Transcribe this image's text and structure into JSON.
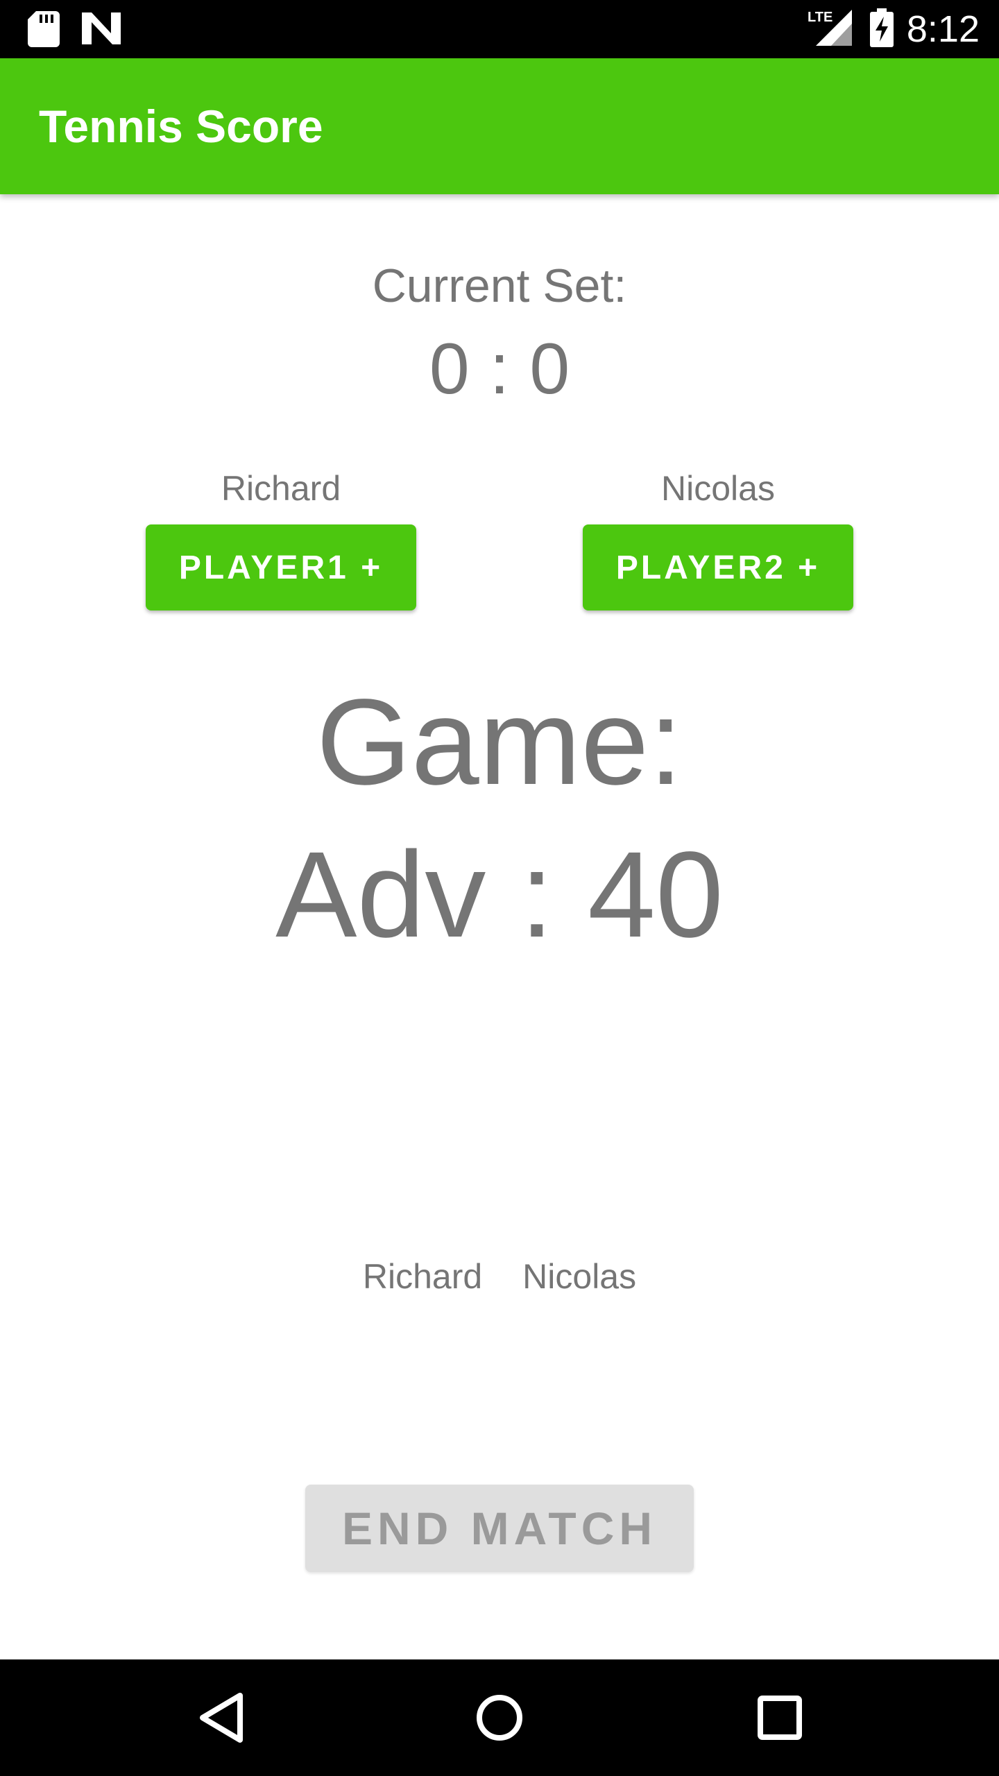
{
  "status_bar": {
    "time": "8:12",
    "network_label": "LTE",
    "icons": [
      "sd-card-icon",
      "n-logo-icon",
      "lte-signal-icon",
      "battery-charging-icon"
    ]
  },
  "app_bar": {
    "title": "Tennis Score",
    "color": "#4cc70f"
  },
  "current_set": {
    "label": "Current Set:",
    "score": "0 : 0"
  },
  "players": [
    {
      "name": "Richard",
      "button_label": "PLAYER1 +"
    },
    {
      "name": "Nicolas",
      "button_label": "PLAYER2 +"
    }
  ],
  "game": {
    "label": "Game:",
    "score": "Adv : 40"
  },
  "set_history": {
    "names": [
      "Richard",
      "Nicolas"
    ]
  },
  "end_match": {
    "label": "END MATCH"
  },
  "nav_bar": {
    "icons": [
      "back-icon",
      "home-icon",
      "recents-icon"
    ]
  },
  "colors": {
    "accent": "#4cc70f",
    "text_secondary": "#757575",
    "disabled_bg": "#dfdfdf"
  }
}
